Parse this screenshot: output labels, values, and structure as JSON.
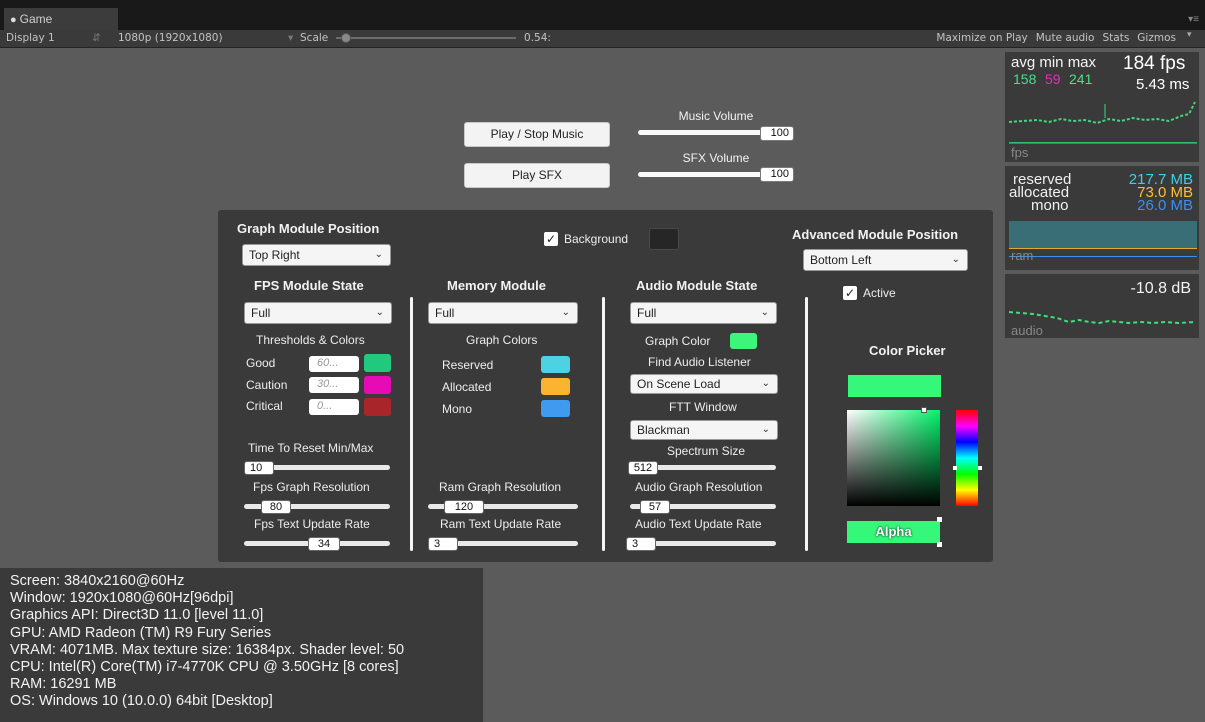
{
  "window": {
    "tab_label": "Game",
    "display": "Display 1",
    "resolution": "1080p (1920x1080)",
    "scale_label": "Scale",
    "scale_value": "0.54:",
    "maximize": "Maximize on Play",
    "mute": "Mute audio",
    "stats": "Stats",
    "gizmos": "Gizmos"
  },
  "controls": {
    "play_stop_music": "Play / Stop Music",
    "play_sfx": "Play SFX",
    "music_volume_label": "Music Volume",
    "music_volume": "100",
    "sfx_volume_label": "SFX Volume",
    "sfx_volume": "100"
  },
  "panel": {
    "graph_module_position_title": "Graph Module Position",
    "graph_module_position_value": "Top Right",
    "background_label": "Background",
    "advanced_module_position_title": "Advanced Module Position",
    "advanced_module_position_value": "Bottom Left",
    "active_label": "Active",
    "fps": {
      "title": "FPS Module State",
      "state": "Full",
      "thresholds_title": "Thresholds & Colors",
      "good_label": "Good",
      "good_placeholder": "60...",
      "caution_label": "Caution",
      "caution_placeholder": "30...",
      "critical_label": "Critical",
      "critical_placeholder": "0...",
      "reset_label": "Time To Reset Min/Max",
      "reset_value": "10",
      "graph_res_label": "Fps Graph Resolution",
      "graph_res_value": "80",
      "text_rate_label": "Fps Text Update Rate",
      "text_rate_value": "34"
    },
    "memory": {
      "title": "Memory Module",
      "state": "Full",
      "graph_colors_title": "Graph Colors",
      "reserved_label": "Reserved",
      "allocated_label": "Allocated",
      "mono_label": "Mono",
      "graph_res_label": "Ram Graph Resolution",
      "graph_res_value": "120",
      "text_rate_label": "Ram Text Update Rate",
      "text_rate_value": "3"
    },
    "audio": {
      "title": "Audio Module State",
      "state": "Full",
      "graph_color_label": "Graph Color",
      "find_listener_label": "Find Audio Listener",
      "find_listener_value": "On Scene Load",
      "fft_window_label": "FTT Window",
      "fft_window_value": "Blackman",
      "spectrum_size_label": "Spectrum Size",
      "spectrum_size_value": "512",
      "graph_res_label": "Audio Graph Resolution",
      "graph_res_value": "57",
      "text_rate_label": "Audio Text Update Rate",
      "text_rate_value": "3"
    },
    "color_picker_title": "Color Picker",
    "alpha_label": "Alpha"
  },
  "colors": {
    "good": "#21c97d",
    "caution": "#e60bb4",
    "critical": "#a8262a",
    "reserved": "#4dd2e3",
    "allocated": "#fbb431",
    "mono": "#3f9af0",
    "audio_graph": "#3cf57a",
    "picker": "#35f77a",
    "fps_avg": "#48e08a",
    "fps_min": "#e52eb3",
    "mem_reserved": "#3ad0e8",
    "mem_allocated": "#ffbf2e",
    "mem_mono": "#3c8ef0"
  },
  "fps_graph": {
    "header_labels": "avg min max",
    "avg": "158",
    "min": "59",
    "max": "241",
    "fps_value": "184 fps",
    "ms_value": "5.43 ms",
    "label": "fps"
  },
  "ram_graph": {
    "reserved_label": "reserved",
    "allocated_label": "allocated",
    "mono_label": "mono",
    "reserved_value": "217.7 MB",
    "allocated_value": "73.0 MB",
    "mono_value": "26.0 MB",
    "label": "ram"
  },
  "audio_graph": {
    "db_value": "-10.8 dB",
    "label": "audio"
  },
  "info": [
    "Screen: 3840x2160@60Hz",
    "Window: 1920x1080@60Hz[96dpi]",
    "Graphics API: Direct3D 11.0 [level 11.0]",
    "GPU: AMD Radeon (TM) R9 Fury Series",
    "VRAM: 4071MB. Max texture size: 16384px. Shader level: 50",
    "CPU: Intel(R) Core(TM) i7-4770K CPU @ 3.50GHz [8 cores]",
    "RAM: 16291 MB",
    "OS: Windows 10  (10.0.0) 64bit [Desktop]"
  ]
}
